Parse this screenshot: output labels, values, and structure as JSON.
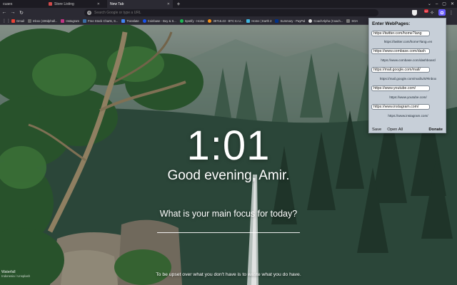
{
  "tabs": [
    {
      "label": "cuaes",
      "active": false
    },
    {
      "label": "Store Listing",
      "active": false
    },
    {
      "label": "New Tab",
      "active": true
    }
  ],
  "address_bar": {
    "placeholder": "Search Google or type a URL"
  },
  "extension_badge_count": "12",
  "bookmarks": [
    {
      "label": "Gmail",
      "color": "#ea4335"
    },
    {
      "label": "Inbox (436dphall...",
      "color": "#555"
    },
    {
      "label": "Instagram",
      "color": "#c13584"
    },
    {
      "label": "Free Stock Charts, S...",
      "color": "#3a6ea5"
    },
    {
      "label": "Translate",
      "color": "#4285f4"
    },
    {
      "label": "Coinbase - Buy & S...",
      "color": "#1652f0"
    },
    {
      "label": "Spotify - Home",
      "color": "#1db954"
    },
    {
      "label": "39716.43 - BTC to U...",
      "color": "#f7931a"
    },
    {
      "label": "Home | Earth 2",
      "color": "#3fb5e0"
    },
    {
      "label": "Summary - PayPal",
      "color": "#003087"
    },
    {
      "label": "CoachAlpha (Coach...",
      "color": "#ddd"
    },
    {
      "label": "SOA",
      "color": "#777"
    }
  ],
  "clock": "1:01",
  "greeting": "Good evening, Amir.",
  "focus_question": "What is your main focus for today?",
  "quote": "To be upset over what you don't have is to waste what you do have.",
  "photo_credit": {
    "title": "Waterfall",
    "author": "Indonesia / Unsplash"
  },
  "popup": {
    "title": "Enter WebPages:",
    "entries": [
      {
        "value": "https://twitter.com/home?lang",
        "saved": "https://twitter.com/home?lang=en"
      },
      {
        "value": "https://www.combase.com/dash",
        "saved": "https://www.combase.com/dashboard"
      },
      {
        "value": "https://mail.google.com/mail/",
        "saved": "https://mail.google.com/mail/u/0/#inbox"
      },
      {
        "value": "https://www.youtube.com/",
        "saved": "https://www.youtube.com/"
      },
      {
        "value": "https://www.instagram.com/",
        "saved": "https://www.instagram.com/"
      }
    ],
    "save_label": "Save",
    "open_all_label": "Open All",
    "donate_label": "Donate"
  }
}
